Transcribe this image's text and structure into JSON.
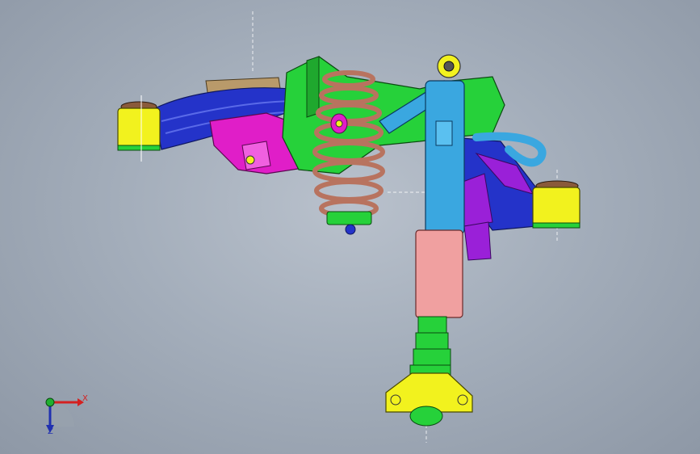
{
  "viewport": {
    "background": "#a4aebb",
    "triad": {
      "x_label": "X",
      "z_label": "Z"
    }
  },
  "parts": {
    "coil_spring": "#b8735f",
    "shock_rod": "#3aa7e0",
    "shock_body": "#f0a0a0",
    "knuckle": "#26d13a",
    "upper_arm": "#2433c9",
    "lower_arm": "#e01ec8",
    "bushing": "#f2f21e",
    "bracket_purple": "#9a20d8",
    "tan_part": "#b99a6a"
  }
}
